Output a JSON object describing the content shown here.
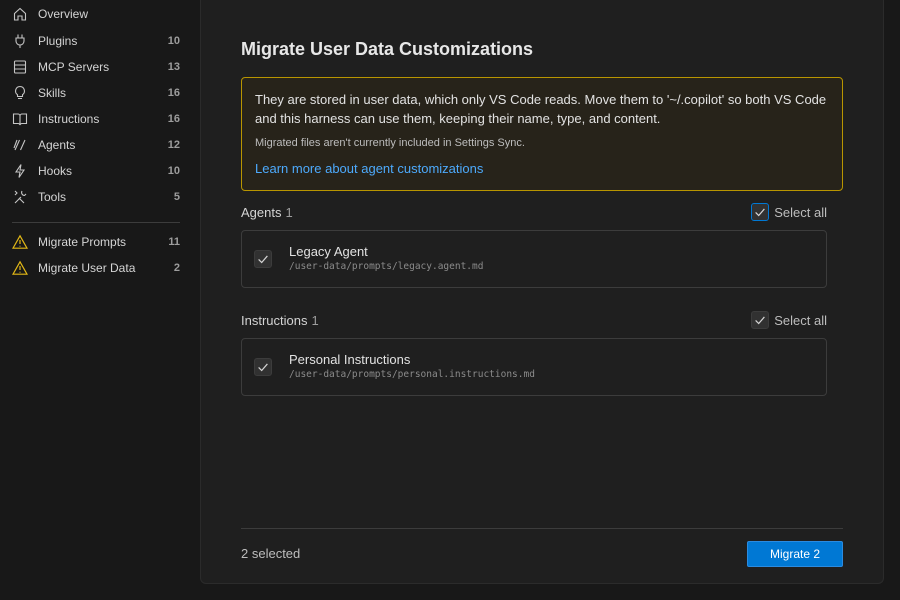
{
  "sidebar": {
    "items": [
      {
        "label": "Overview",
        "count": "",
        "icon": "home-icon"
      },
      {
        "label": "Plugins",
        "count": "10",
        "icon": "plug-icon"
      },
      {
        "label": "MCP Servers",
        "count": "13",
        "icon": "server-icon"
      },
      {
        "label": "Skills",
        "count": "16",
        "icon": "lightbulb-icon"
      },
      {
        "label": "Instructions",
        "count": "16",
        "icon": "book-icon"
      },
      {
        "label": "Agents",
        "count": "12",
        "icon": "agent-icon"
      },
      {
        "label": "Hooks",
        "count": "10",
        "icon": "lightning-icon"
      },
      {
        "label": "Tools",
        "count": "5",
        "icon": "tools-icon"
      }
    ],
    "migrate_items": [
      {
        "label": "Migrate Prompts",
        "count": "11",
        "icon": "warning-icon"
      },
      {
        "label": "Migrate User Data",
        "count": "2",
        "icon": "warning-icon"
      }
    ]
  },
  "main": {
    "title": "Migrate User Data Customizations",
    "notice": {
      "text": "They are stored in user data, which only VS Code reads. Move them to '~/.copilot' so both VS Code and this harness can use them, keeping their name, type, and content.",
      "subtext": "Migrated files aren't currently included in Settings Sync.",
      "link": "Learn more about agent customizations",
      "border_color": "#b89500"
    },
    "sections": [
      {
        "title": "Agents",
        "count": "1",
        "select_all_label": "Select all",
        "items": [
          {
            "name": "Legacy Agent",
            "path": "/user-data/prompts/legacy.agent.md",
            "checked": true
          }
        ]
      },
      {
        "title": "Instructions",
        "count": "1",
        "select_all_label": "Select all",
        "items": [
          {
            "name": "Personal Instructions",
            "path": "/user-data/prompts/personal.instructions.md",
            "checked": true
          }
        ]
      }
    ],
    "footer": {
      "status": "2 selected",
      "button_label": "Migrate 2"
    }
  },
  "colors": {
    "accent": "#0078d4",
    "link": "#4daafc",
    "warning": "#e2b816"
  }
}
